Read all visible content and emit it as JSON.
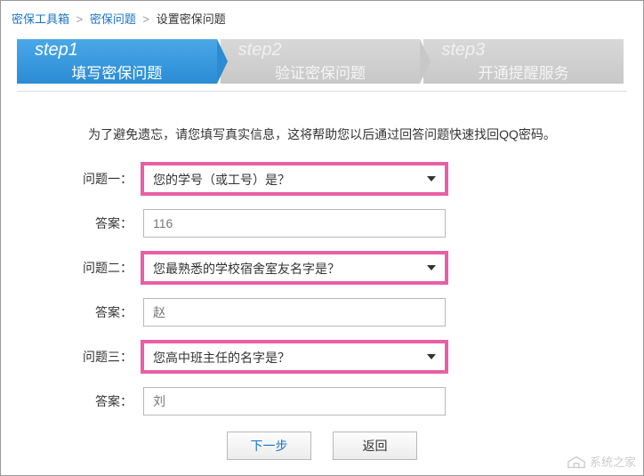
{
  "breadcrumb": {
    "item1": "密保工具箱",
    "item2": "密保问题",
    "current": "设置密保问题"
  },
  "steps": [
    {
      "num": "step1",
      "label": "填写密保问题"
    },
    {
      "num": "step2",
      "label": "验证密保问题"
    },
    {
      "num": "step3",
      "label": "开通提醒服务"
    }
  ],
  "hint": "为了避免遗忘，请您填写真实信息，这将帮助您以后通过回答问题快速找回QQ密码。",
  "fields": {
    "q1_label": "问题一：",
    "q1_value": "您的学号（或工号）是？",
    "a1_label": "答案：",
    "a1_value": "116",
    "q2_label": "问题二：",
    "q2_value": "您最熟悉的学校宿舍室友名字是？",
    "a2_label": "答案：",
    "a2_value": "赵",
    "q3_label": "问题三：",
    "q3_value": "您高中班主任的名字是？",
    "a3_label": "答案：",
    "a3_value": "刘"
  },
  "buttons": {
    "next": "下一步",
    "back": "返回"
  },
  "watermark": "系统之家"
}
